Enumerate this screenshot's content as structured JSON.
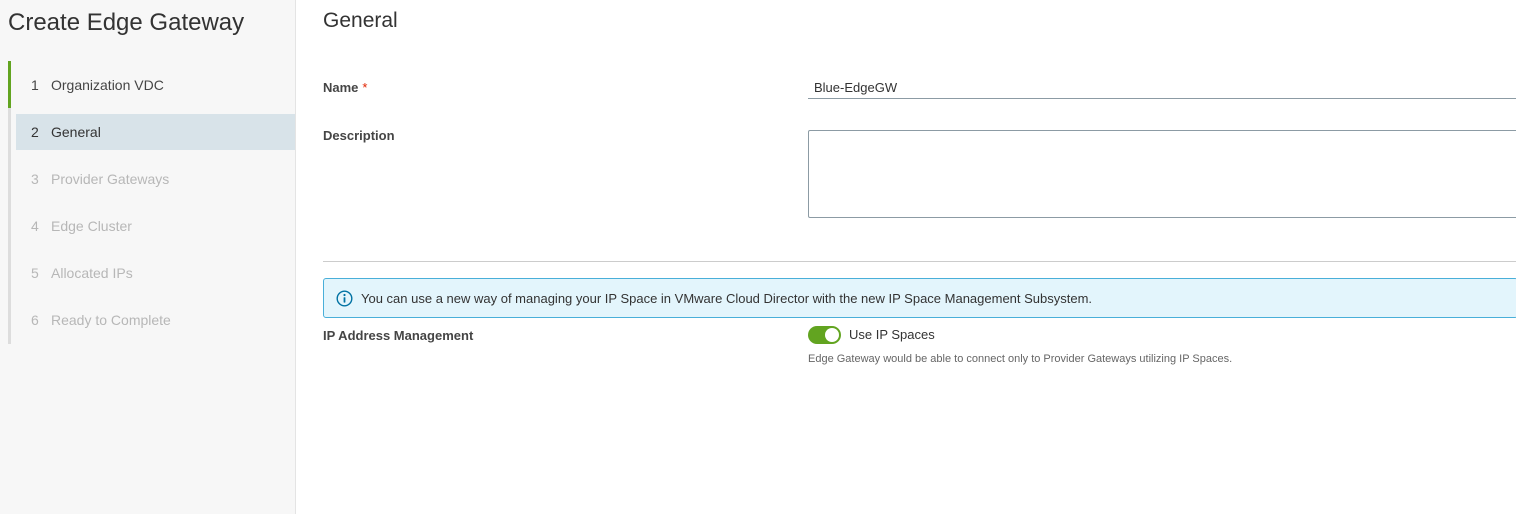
{
  "wizard": {
    "title": "Create Edge Gateway",
    "steps": [
      {
        "number": "1",
        "label": "Organization VDC",
        "state": "done"
      },
      {
        "number": "2",
        "label": "General",
        "state": "active"
      },
      {
        "number": "3",
        "label": "Provider Gateways",
        "state": "disabled"
      },
      {
        "number": "4",
        "label": "Edge Cluster",
        "state": "disabled"
      },
      {
        "number": "5",
        "label": "Allocated IPs",
        "state": "disabled"
      },
      {
        "number": "6",
        "label": "Ready to Complete",
        "state": "disabled"
      }
    ]
  },
  "page": {
    "title": "General"
  },
  "form": {
    "name": {
      "label": "Name",
      "required_mark": "*",
      "value": "Blue-EdgeGW"
    },
    "description": {
      "label": "Description",
      "value": ""
    },
    "info_alert": {
      "icon": "info-circle-icon",
      "text": "You can use a new way of managing your IP Space in VMware Cloud Director with the new IP Space Management Subsystem."
    },
    "ip_management": {
      "label": "IP Address Management",
      "toggle_label": "Use IP Spaces",
      "toggle_on": true,
      "helper_text": "Edge Gateway would be able to connect only to Provider Gateways utilizing IP Spaces."
    }
  },
  "colors": {
    "accent_green": "#62a420",
    "active_step_bg": "#d8e3e9",
    "info_bg": "#e3f5fc",
    "info_border": "#49afd9",
    "required_red": "#e12200"
  }
}
